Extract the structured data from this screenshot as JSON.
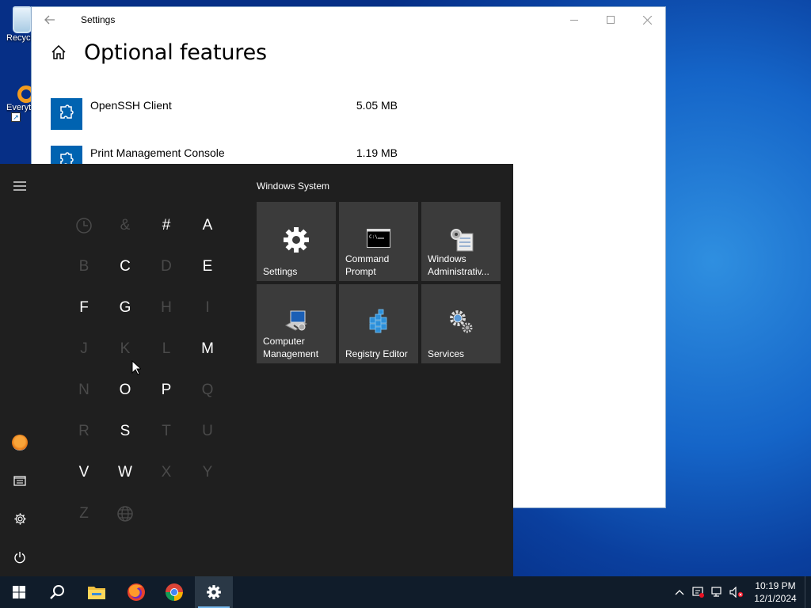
{
  "desktop": {
    "icons": [
      {
        "label": "Recycle Bin",
        "icon": "recycle-bin-icon"
      },
      {
        "label": "Everything",
        "icon": "everything-search-icon"
      }
    ]
  },
  "settings_window": {
    "title": "Settings",
    "page_title": "Optional features",
    "features": [
      {
        "name": "OpenSSH Client",
        "size": "5.05 MB",
        "icon": "puzzle-icon"
      },
      {
        "name": "Print Management Console",
        "size": "1.19 MB",
        "icon": "puzzle-icon"
      }
    ]
  },
  "start_menu": {
    "letters": [
      {
        "char": "🕓",
        "enabled": false,
        "icon": "clock-icon"
      },
      {
        "char": "&",
        "enabled": false
      },
      {
        "char": "#",
        "enabled": true
      },
      {
        "char": "A",
        "enabled": true
      },
      {
        "char": "B",
        "enabled": false
      },
      {
        "char": "C",
        "enabled": true
      },
      {
        "char": "D",
        "enabled": false
      },
      {
        "char": "E",
        "enabled": true
      },
      {
        "char": "F",
        "enabled": true
      },
      {
        "char": "G",
        "enabled": true
      },
      {
        "char": "H",
        "enabled": false
      },
      {
        "char": "I",
        "enabled": false
      },
      {
        "char": "J",
        "enabled": false
      },
      {
        "char": "K",
        "enabled": false
      },
      {
        "char": "L",
        "enabled": false
      },
      {
        "char": "M",
        "enabled": true
      },
      {
        "char": "N",
        "enabled": false
      },
      {
        "char": "O",
        "enabled": true
      },
      {
        "char": "P",
        "enabled": true
      },
      {
        "char": "Q",
        "enabled": false
      },
      {
        "char": "R",
        "enabled": false
      },
      {
        "char": "S",
        "enabled": true
      },
      {
        "char": "T",
        "enabled": false
      },
      {
        "char": "U",
        "enabled": false
      },
      {
        "char": "V",
        "enabled": true
      },
      {
        "char": "W",
        "enabled": true
      },
      {
        "char": "X",
        "enabled": false
      },
      {
        "char": "Y",
        "enabled": false
      },
      {
        "char": "Z",
        "enabled": false
      },
      {
        "char": "🌐",
        "enabled": false,
        "icon": "globe-icon"
      }
    ],
    "group_title": "Windows System",
    "tiles": [
      {
        "label": "Settings",
        "icon": "gear-icon"
      },
      {
        "label": "Command\nPrompt",
        "icon": "command-prompt-icon"
      },
      {
        "label": "Windows\nAdministrativ...",
        "icon": "admin-tools-icon"
      },
      {
        "label": "Computer\nManagement",
        "icon": "computer-management-icon"
      },
      {
        "label": "Registry Editor",
        "icon": "registry-editor-icon"
      },
      {
        "label": "Services",
        "icon": "services-gears-icon"
      }
    ],
    "rail": [
      "hamburger-menu-icon",
      "user-avatar-icon",
      "documents-icon",
      "settings-gear-icon",
      "power-icon"
    ]
  },
  "taskbar": {
    "pinned": [
      "windows-start-icon",
      "search-icon",
      "file-explorer-icon",
      "firefox-icon",
      "chrome-icon",
      "settings-gear-icon"
    ],
    "tray": [
      "chevron-up-icon",
      "security-icon",
      "network-icon",
      "volume-muted-icon"
    ],
    "time": "10:19 PM",
    "date": "12/1/2024"
  },
  "colors": {
    "accent": "#0063b1",
    "start_bg": "#1f1f1f",
    "tile_bg": "#3b3b3b",
    "taskbar_bg": "#101c2a"
  }
}
